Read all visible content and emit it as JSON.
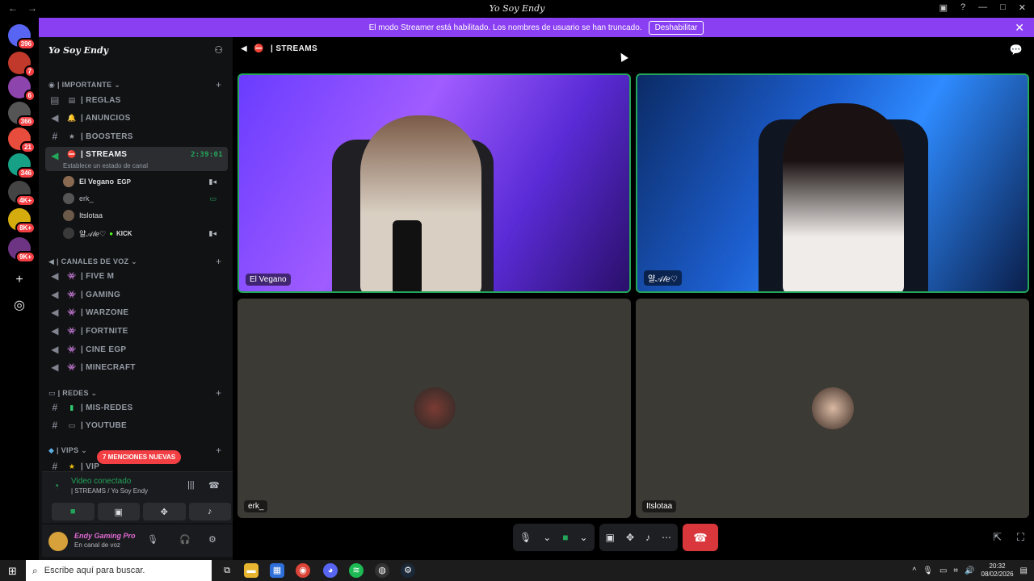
{
  "window": {
    "title": "Yo Soy Endy",
    "back": "←",
    "forward": "→",
    "controls": [
      "▣",
      "?",
      "—",
      "□",
      "✕"
    ]
  },
  "banner": {
    "text": "El modo Streamer está habilitado. Los nombres de usuario se han truncado.",
    "button": "Deshabilitar",
    "close": "✕"
  },
  "servers": [
    {
      "badge": "396",
      "color": "#5865f2"
    },
    {
      "badge": "7",
      "color": "#c0392b"
    },
    {
      "badge": "6",
      "color": "#8e44ad"
    },
    {
      "badge": "366",
      "color": "#555"
    },
    {
      "badge": "21",
      "color": "#e74c3c"
    },
    {
      "badge": "346",
      "color": "#16a085"
    },
    {
      "badge": "4K+",
      "color": "#444"
    },
    {
      "badge": "8K+",
      "color": "#d4ac0d"
    },
    {
      "badge": "9K+",
      "color": "#6c3483"
    }
  ],
  "sidebar": {
    "server_name": "Yo Soy Endy",
    "categories": {
      "importante": "IMPORTANTE",
      "voz": "CANALES DE VOZ",
      "redes": "REDES",
      "vips": "VIPS"
    },
    "channels": {
      "reglas": "| REGLAS",
      "anuncios": "| ANUNCIOS",
      "boosters": "| BOOSTERS",
      "streams": "| STREAMS",
      "streams_time": "2:39:01",
      "streams_status": "Establece un estado de canal",
      "fivem": "| FIVE M",
      "gaming": "| GAMING",
      "warzone": "| WARZONE",
      "fortnite": "| FORTNITE",
      "cine": "| CINE EGP",
      "minecraft": "| MINECRAFT",
      "misredes": "| MIS-REDES",
      "youtube": "| YOUTUBE",
      "vip": "| VIP"
    },
    "voice_users": [
      {
        "name": "El Vegano",
        "tag": "EGP"
      },
      {
        "name": "erk_",
        "tag": ""
      },
      {
        "name": "Itslotaa",
        "tag": ""
      },
      {
        "name": "얄𝒜𝓁ℯ♡",
        "tag": "KICK"
      }
    ],
    "mentions": "7 MENCIONES NUEVAS"
  },
  "voice_panel": {
    "title": "Video conectado",
    "subtitle": "| STREAMS / Yo Soy Endy"
  },
  "user_panel": {
    "name": "Endy Gaming Pro",
    "status": "En canal de voz"
  },
  "main": {
    "channel": "| STREAMS",
    "tiles": [
      {
        "label": "El Vegano"
      },
      {
        "label": "얄𝒜𝓁ℯ♡"
      },
      {
        "label": "erk_"
      },
      {
        "label": "Itslotaa"
      }
    ]
  },
  "taskbar": {
    "search_placeholder": "Escribe aquí para buscar.",
    "time": "20:32",
    "date": "08/02/2026"
  },
  "colors": {
    "accent": "#8a3ff2",
    "online": "#23a55a",
    "danger": "#da373c"
  }
}
